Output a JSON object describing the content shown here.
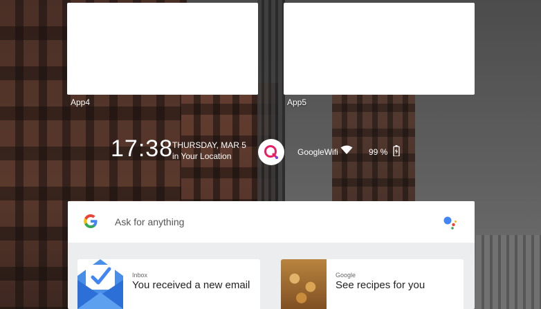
{
  "apps": [
    {
      "label": "App4"
    },
    {
      "label": "App5"
    }
  ],
  "status": {
    "time": "17:38",
    "date": "THURSDAY, MAR 5",
    "location": "in Your Location",
    "wifi_name": "GoogleWifi",
    "battery": "99 %"
  },
  "search": {
    "placeholder": "Ask for anything"
  },
  "cards": [
    {
      "source": "Inbox",
      "title": "You received a new email"
    },
    {
      "source": "Google",
      "title": "See recipes for you"
    }
  ],
  "colors": {
    "google_blue": "#4285F4",
    "google_red": "#EA4335",
    "google_yellow": "#FBBC05",
    "google_green": "#34A853",
    "logo_pink": "#E91E63"
  }
}
